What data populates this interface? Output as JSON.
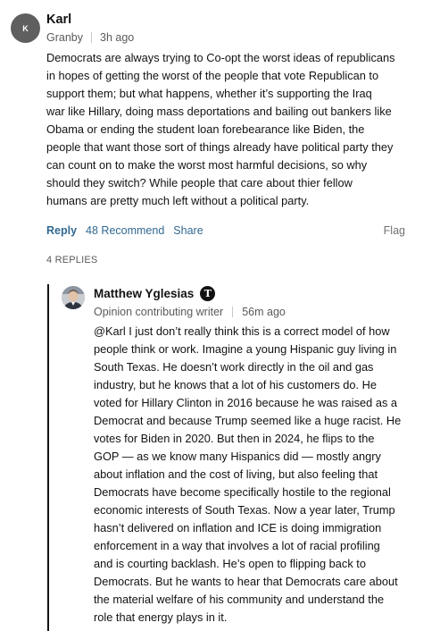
{
  "comment": {
    "avatar_initial": "K",
    "author": "Karl",
    "location": "Granby",
    "time": "3h ago",
    "lines": [
      "Democrats are always trying to Co-opt the worst ideas of republicans",
      "in hopes of getting the worst of the people that vote Republican to",
      "support them;  but what happens, whether it’s supporting the Iraq",
      "war like Hillary, doing mass deportations and bailing out bankers like",
      "Obama or ending the student loan forebearance like Biden, the",
      "people that want those sort of things already have political party they",
      "can count on to make the worst most harmful decisions, so why",
      "should they switch?  While people that care about thier fellow",
      "humans are pretty much left without a political party."
    ],
    "reply_label": "Reply",
    "recommend_label": "48 Recommend",
    "share_label": "Share",
    "flag_label": "Flag",
    "replies_count": "4 REPLIES"
  },
  "reply": {
    "author": "Matthew Yglesias",
    "badge": "T",
    "role": "Opinion contributing writer",
    "time": "56m ago",
    "lines": [
      "@Karl I just don’t really think this is a correct model of how",
      "people think or work. Imagine a young Hispanic guy living in",
      "South Texas. He doesn’t work directly in the oil and gas",
      "industry, but he knows that a lot of his customers do. He",
      "voted for Hillary Clinton in 2016 because he was raised as a",
      "Democrat and because Trump seemed like a huge racist. He",
      "votes for Biden in 2020. But then in 2024, he flips to the",
      "GOP — as we know many Hispanics did — mostly angry",
      "about inflation and the cost of living, but also feeling that",
      "Democrats have become specifically hostile to the regional",
      "economic interests of South Texas. Now a year later, Trump",
      "hasn’t delivered on inflation and ICE is doing immigration",
      "enforcement in a way that involves a lot of racial profiling",
      "and is courting backlash. He’s open to flipping back to",
      "Democrats. But he wants to hear that Democrats care about",
      "the material welfare of his community and understand the",
      "role that energy plays in it."
    ]
  }
}
